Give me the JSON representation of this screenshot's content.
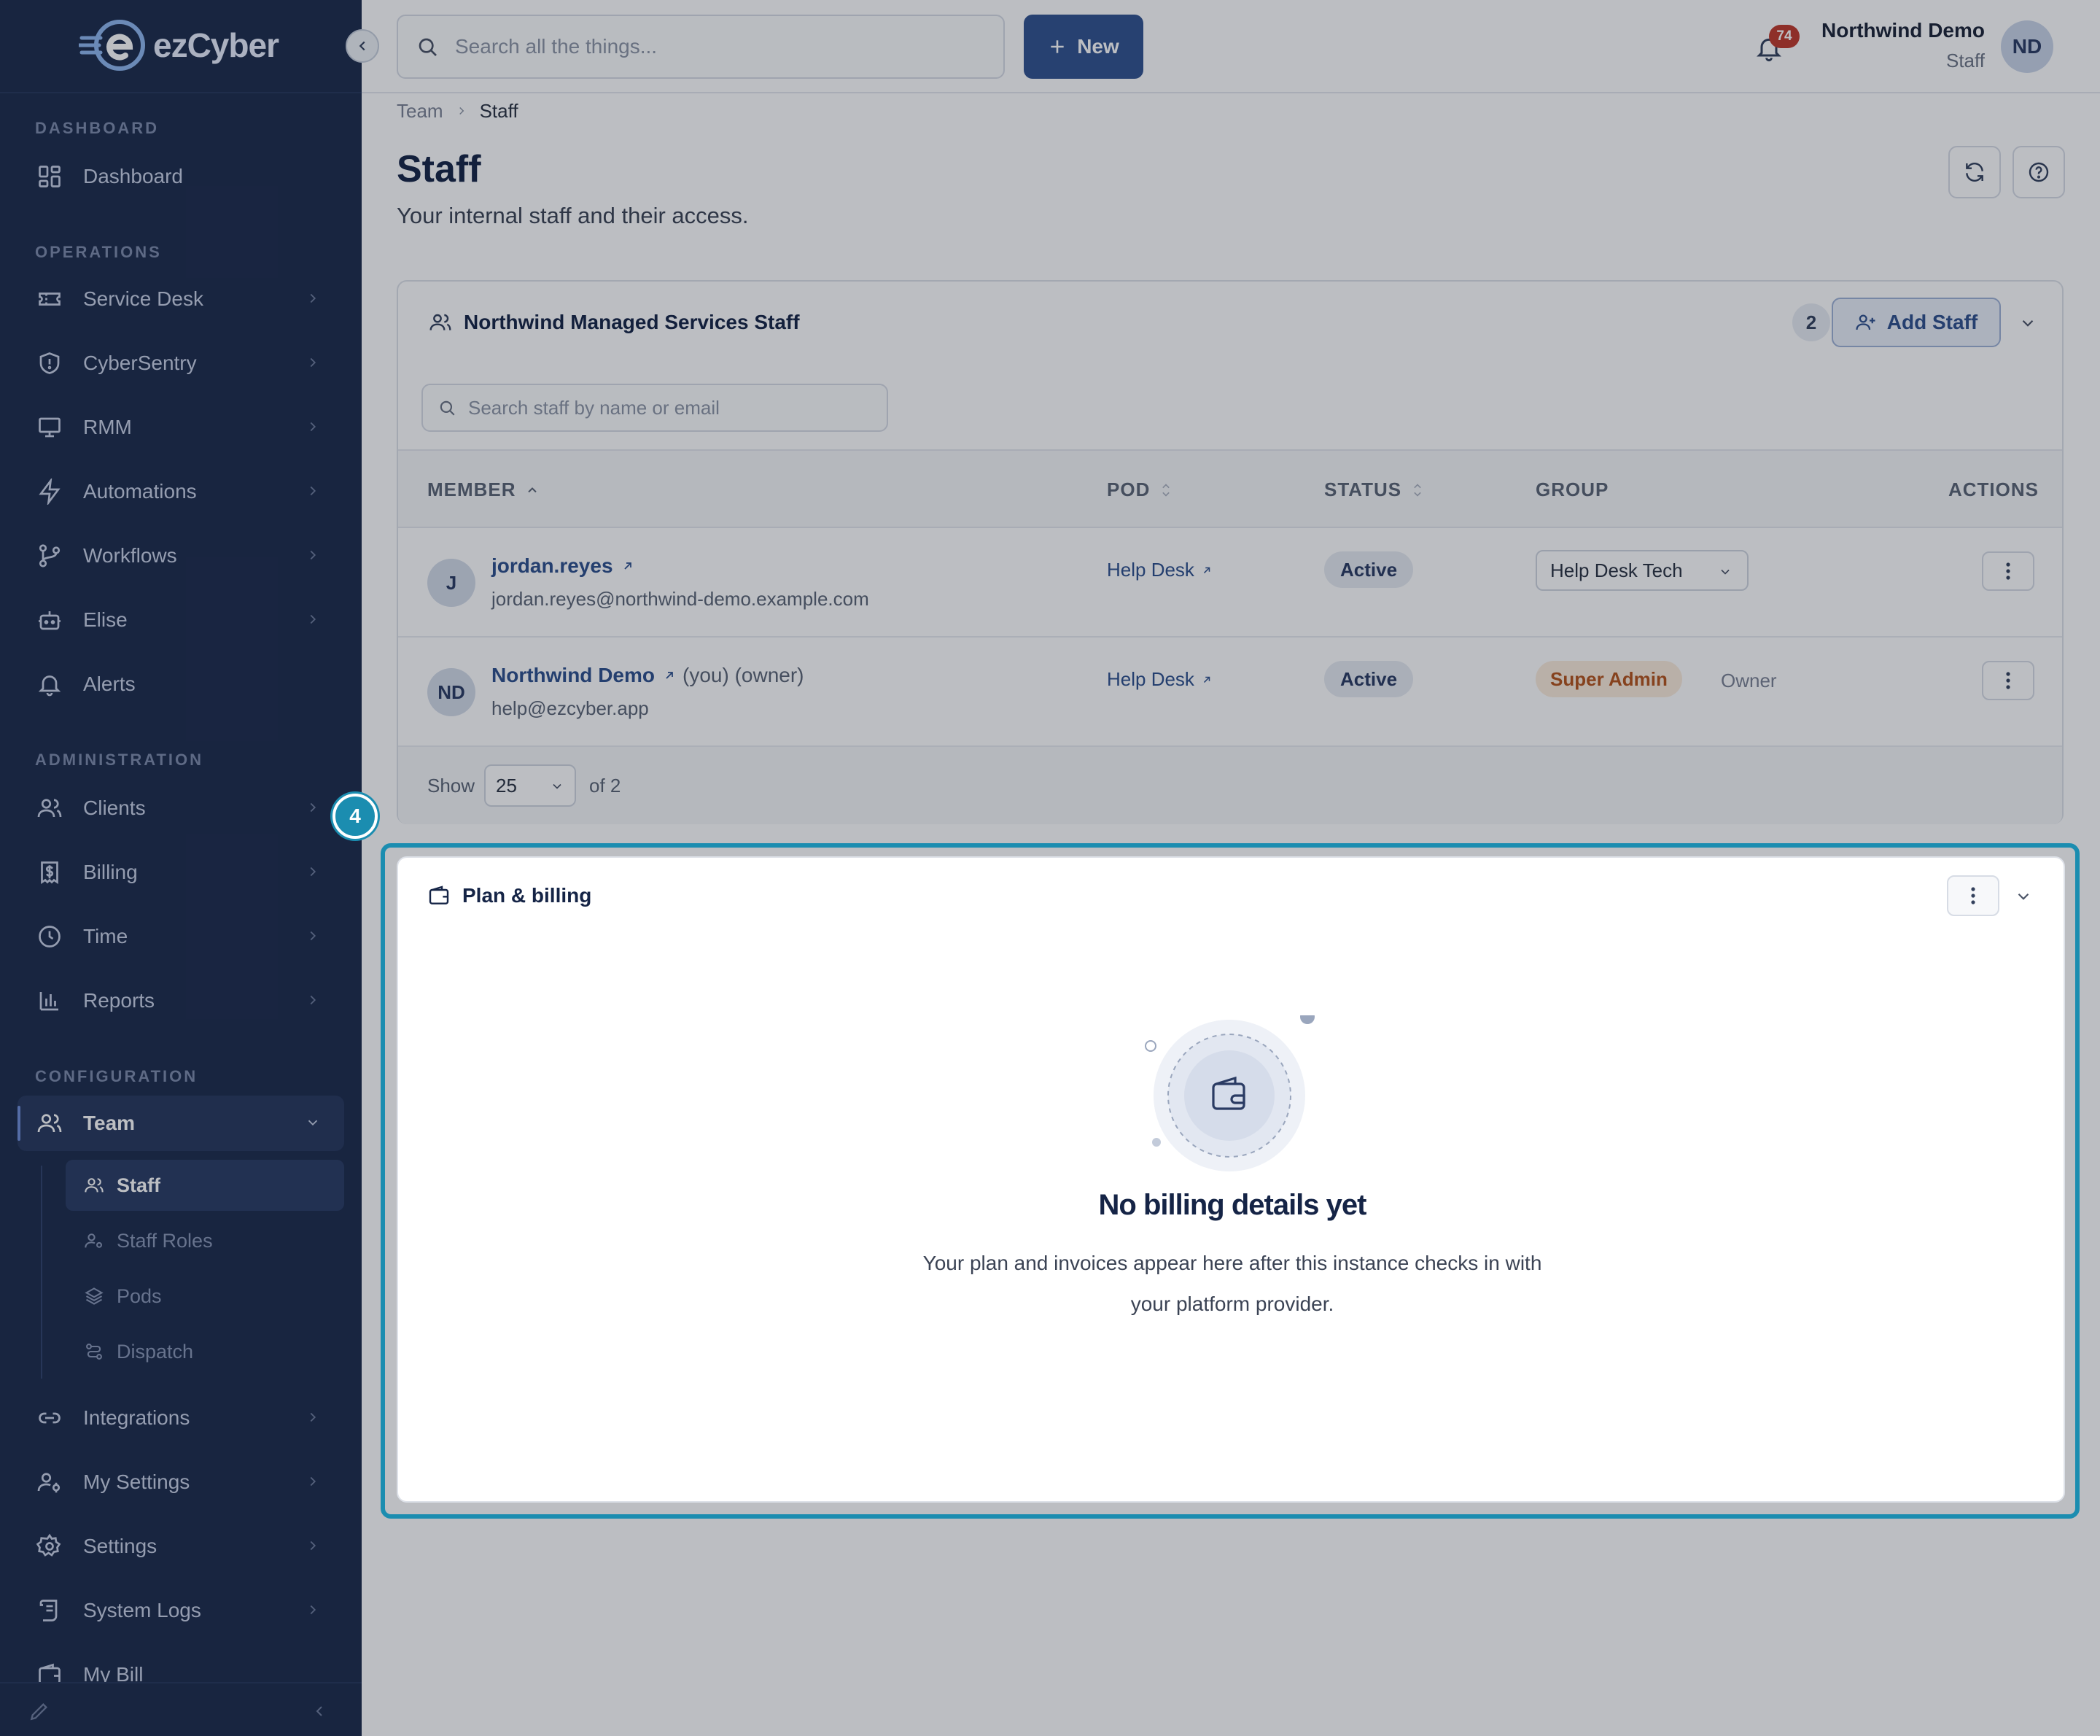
{
  "app": {
    "brand": "ezCyber"
  },
  "topbar": {
    "search_placeholder": "Search all the things...",
    "new_label": "New",
    "notifications_count": "74",
    "user_name": "Northwind Demo",
    "user_role": "Staff",
    "user_initials": "ND"
  },
  "sidebar": {
    "sections": {
      "dashboard": "DASHBOARD",
      "operations": "OPERATIONS",
      "administration": "ADMINISTRATION",
      "configuration": "CONFIGURATION"
    },
    "items": {
      "dashboard": "Dashboard",
      "service_desk": "Service Desk",
      "cybersentry": "CyberSentry",
      "rmm": "RMM",
      "automations": "Automations",
      "workflows": "Workflows",
      "elise": "Elise",
      "alerts": "Alerts",
      "clients": "Clients",
      "billing": "Billing",
      "time": "Time",
      "reports": "Reports",
      "team": "Team",
      "integrations": "Integrations",
      "my_settings": "My Settings",
      "settings": "Settings",
      "system_logs": "System Logs",
      "my_bill": "My Bill"
    },
    "team_sub": {
      "staff": "Staff",
      "staff_roles": "Staff Roles",
      "pods": "Pods",
      "dispatch": "Dispatch"
    }
  },
  "breadcrumb": {
    "parent": "Team",
    "current": "Staff"
  },
  "page": {
    "title": "Staff",
    "subtitle": "Your internal staff and their access."
  },
  "staff_card": {
    "title": "Northwind Managed Services Staff",
    "count": "2",
    "add_label": "Add Staff",
    "search_placeholder": "Search staff by name or email",
    "columns": {
      "member": "MEMBER",
      "pod": "POD",
      "status": "STATUS",
      "group": "GROUP",
      "actions": "ACTIONS"
    },
    "rows": [
      {
        "initials": "J",
        "name": "jordan.reyes",
        "meta": "",
        "email": "jordan.reyes@northwind-demo.example.com",
        "pod": "Help Desk",
        "status": "Active",
        "group": "Help Desk Tech"
      },
      {
        "initials": "ND",
        "name": "Northwind Demo",
        "meta": "(you) (owner)",
        "email": "help@ezcyber.app",
        "pod": "Help Desk",
        "status": "Active",
        "group": "Super Admin",
        "group_note": "Owner"
      }
    ],
    "footer": {
      "show_label": "Show",
      "page_size": "25",
      "total_label": "of 2"
    }
  },
  "billing_card": {
    "title": "Plan & billing",
    "empty_title": "No billing details yet",
    "empty_desc": "Your plan and invoices appear here after this instance checks in with your platform provider."
  },
  "tour": {
    "step": "4"
  },
  "colors": {
    "sidebar_bg": "#1c2b4c",
    "primary": "#31528f",
    "highlight": "#1b8db0",
    "badge_red": "#c0392b",
    "super_admin_bg": "#fbecdc",
    "super_admin_text": "#b4541c"
  },
  "icons": [
    "search-icon",
    "plus-icon",
    "bell-icon",
    "refresh-icon",
    "help-icon",
    "users-icon",
    "user-plus-icon",
    "chevron-down-icon",
    "wallet-icon",
    "kebab-icon",
    "external-link-icon",
    "sort-icon"
  ]
}
